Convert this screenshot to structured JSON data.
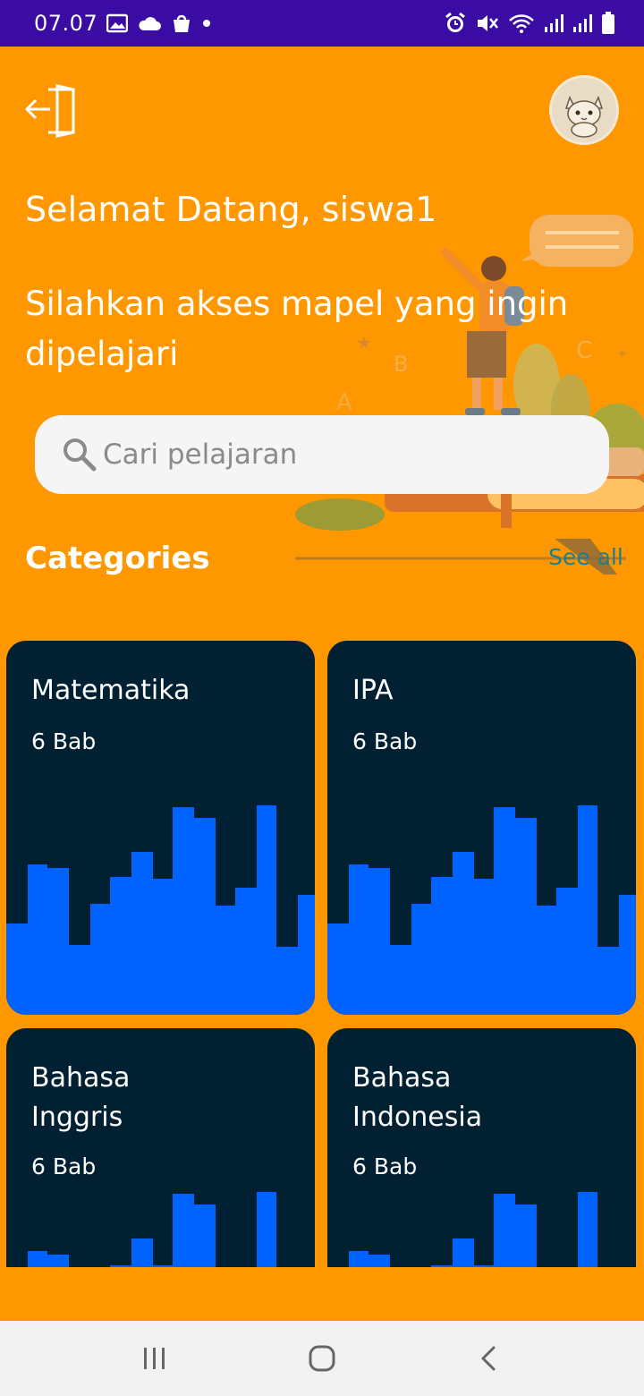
{
  "status_bar": {
    "time": "07.07",
    "left_icons": [
      "image-icon",
      "cloud-icon",
      "shopping-bag-icon",
      "dot-icon"
    ],
    "right_icons": [
      "alarm-icon",
      "mute-icon",
      "wifi-icon",
      "signal-icon",
      "signal-icon",
      "battery-icon"
    ]
  },
  "header": {
    "greeting": "Selamat Datang, siswa1",
    "subtitle": "Silahkan akses mapel yang ingin dipelajari"
  },
  "search": {
    "placeholder": "Cari pelajaran",
    "value": ""
  },
  "categories": {
    "title": "Categories",
    "see_all": "See all",
    "items": [
      {
        "name": "Matematika",
        "count": "6  Bab"
      },
      {
        "name": "IPA",
        "count": "6  Bab"
      },
      {
        "name": "Bahasa Inggris",
        "count": "6  Bab"
      },
      {
        "name": "Bahasa Indonesia",
        "count": "6  Bab"
      }
    ]
  },
  "nav_bar": {
    "buttons": [
      "recent-apps-icon",
      "home-icon",
      "back-icon"
    ]
  },
  "colors": {
    "background": "#FF9800",
    "status_bar": "#3A0CA3",
    "card": "#012133",
    "bars": "#0063FF",
    "see_all": "#1A7F8E"
  }
}
